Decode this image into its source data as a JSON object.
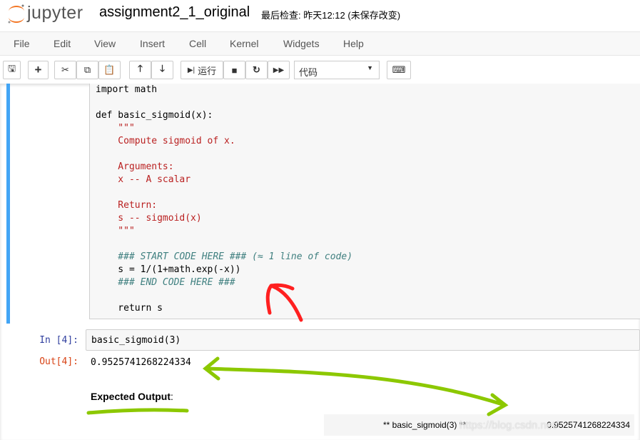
{
  "header": {
    "logo_text": "jupyter",
    "notebook_title": "assignment2_1_original",
    "checkpoint": "最后检查: 昨天12:12  (未保存改变)"
  },
  "menu": [
    "File",
    "Edit",
    "View",
    "Insert",
    "Cell",
    "Kernel",
    "Widgets",
    "Help"
  ],
  "toolbar": {
    "run_label": "运行",
    "cell_type": "代码",
    "icons": [
      "save-icon",
      "plus-icon",
      "scissors-icon",
      "copy-icon",
      "paste-icon",
      "arrow-up-icon",
      "arrow-down-icon",
      "step-forward-icon",
      "stop-icon",
      "restart-icon",
      "fast-forward-icon",
      "keyboard-icon"
    ]
  },
  "cell1": {
    "lines": [
      "import math",
      "",
      "def basic_sigmoid(x):",
      "    \"\"\"",
      "    Compute sigmoid of x.",
      "",
      "    Arguments:",
      "    x -- A scalar",
      "",
      "    Return:",
      "    s -- sigmoid(x)",
      "    \"\"\"",
      "",
      "    ### START CODE HERE ### (≈ 1 line of code)",
      "    s = 1/(1+math.exp(-x))",
      "    ### END CODE HERE ###",
      "",
      "    return s"
    ]
  },
  "cell2": {
    "in_prompt": "In  [4]:",
    "code": "basic_sigmoid(3)",
    "out_prompt": "Out[4]:",
    "output": "0.9525741268224334"
  },
  "expected": {
    "label": "Expected Output",
    "colon": ":",
    "row_label": "** basic_sigmoid(3) **",
    "row_value": "0.9525741268224334"
  },
  "watermark": "https://blog.csdn.net/",
  "colors": {
    "accent": "#42a5f5",
    "annotation_red": "#ff2020",
    "annotation_green": "#8cc800"
  }
}
